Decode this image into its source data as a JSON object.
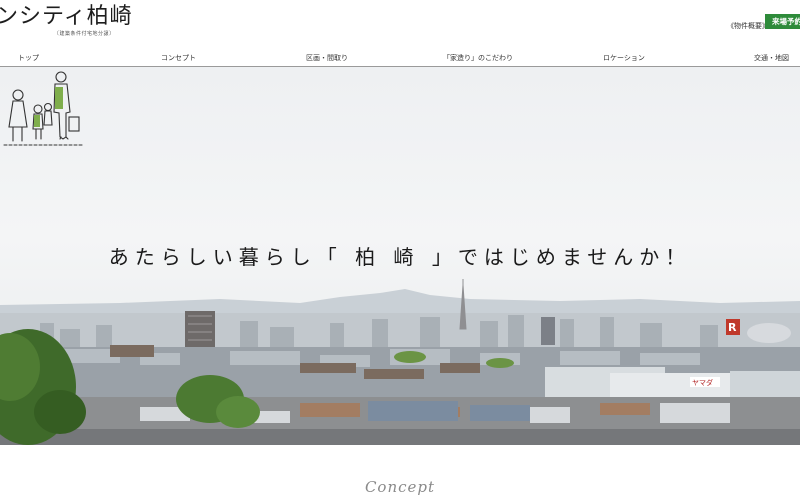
{
  "header": {
    "logo_text": "ンシティ柏崎",
    "logo_subtext": "〔建築条件付宅地分譲〕",
    "outline_link": "《物件概要》",
    "visit_button": "来場予約"
  },
  "nav": {
    "items": [
      {
        "label": "トップ"
      },
      {
        "label": "コンセプト"
      },
      {
        "label": "区画・間取り"
      },
      {
        "label": "「家造り」のこだわり"
      },
      {
        "label": "ロケーション"
      },
      {
        "label": "交通・地図"
      }
    ]
  },
  "hero": {
    "tagline": "あたらしい暮らし「 柏 崎 」ではじめませんか！",
    "illustration": "family-illustration",
    "background": "city-skyline-photo",
    "roof_sign_text": "ヤマダ"
  },
  "section": {
    "concept_label": "Concept"
  },
  "colors": {
    "accent_green": "#2e8b3a",
    "nav_border": "#9a9a9a"
  }
}
